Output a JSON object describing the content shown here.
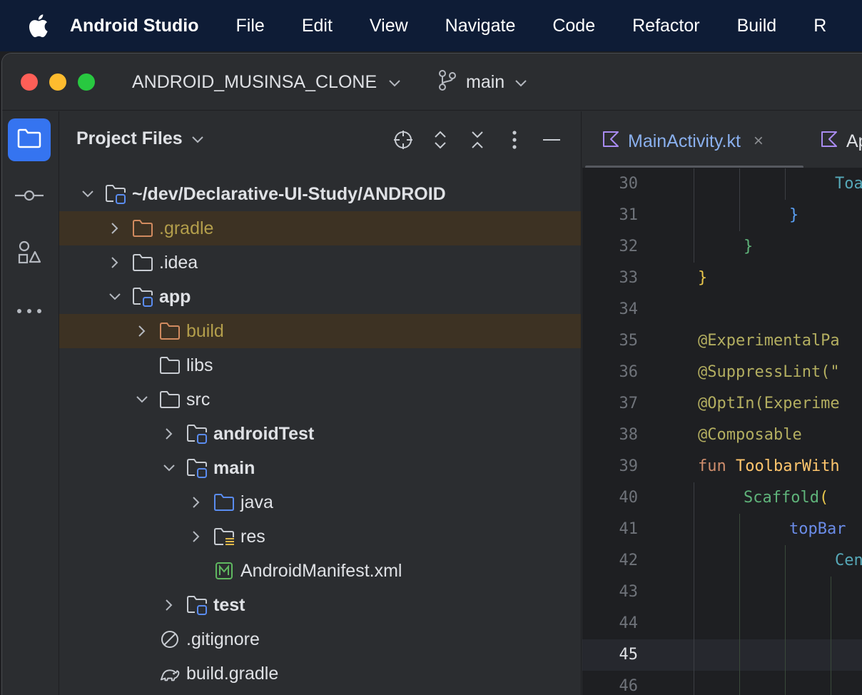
{
  "menubar": {
    "app_name": "Android Studio",
    "items": [
      "File",
      "Edit",
      "View",
      "Navigate",
      "Code",
      "Refactor",
      "Build",
      "R"
    ]
  },
  "titlebar": {
    "project": "ANDROID_MUSINSA_CLONE",
    "branch": "main"
  },
  "colors": {
    "accent": "#3574f0",
    "menubar_bg": "#0e1c36",
    "panel_bg": "#2b2d30",
    "editor_bg": "#1e1f22",
    "excluded_bg": "#3d3223"
  },
  "toolstrip": {
    "icons": [
      "folder-icon",
      "commit-icon",
      "shapes-icon",
      "more-icon"
    ]
  },
  "project_panel": {
    "title": "Project Files",
    "tree": [
      {
        "label": "~/dev/Declarative-UI-Study/ANDROID",
        "indent": 0,
        "arrow": "down",
        "icon": "module",
        "bold": true,
        "excluded": false
      },
      {
        "label": ".gradle",
        "indent": 1,
        "arrow": "right",
        "icon": "folder-excluded",
        "bold": false,
        "excluded": true
      },
      {
        "label": ".idea",
        "indent": 1,
        "arrow": "right",
        "icon": "folder",
        "bold": false,
        "excluded": false
      },
      {
        "label": "app",
        "indent": 1,
        "arrow": "down",
        "icon": "module",
        "bold": true,
        "excluded": false
      },
      {
        "label": "build",
        "indent": 2,
        "arrow": "right",
        "icon": "folder-excluded",
        "bold": false,
        "excluded": true
      },
      {
        "label": "libs",
        "indent": 2,
        "arrow": "none",
        "icon": "folder",
        "bold": false,
        "excluded": false
      },
      {
        "label": "src",
        "indent": 2,
        "arrow": "down",
        "icon": "folder",
        "bold": false,
        "excluded": false
      },
      {
        "label": "androidTest",
        "indent": 3,
        "arrow": "right",
        "icon": "module",
        "bold": true,
        "excluded": false
      },
      {
        "label": "main",
        "indent": 3,
        "arrow": "down",
        "icon": "module",
        "bold": true,
        "excluded": false
      },
      {
        "label": "java",
        "indent": 4,
        "arrow": "right",
        "icon": "folder-source",
        "bold": false,
        "excluded": false
      },
      {
        "label": "res",
        "indent": 4,
        "arrow": "right",
        "icon": "folder-res",
        "bold": false,
        "excluded": false
      },
      {
        "label": "AndroidManifest.xml",
        "indent": 4,
        "arrow": "none",
        "icon": "manifest",
        "bold": false,
        "excluded": false
      },
      {
        "label": "test",
        "indent": 3,
        "arrow": "right",
        "icon": "module",
        "bold": true,
        "excluded": false
      },
      {
        "label": ".gitignore",
        "indent": 2,
        "arrow": "none",
        "icon": "ignore",
        "bold": false,
        "excluded": false
      },
      {
        "label": "build.gradle",
        "indent": 2,
        "arrow": "none",
        "icon": "gradle",
        "bold": false,
        "excluded": false
      }
    ]
  },
  "editor": {
    "tabs": [
      {
        "label": "MainActivity.kt",
        "active": true
      },
      {
        "label": "Ap",
        "active": false
      }
    ],
    "lines": [
      {
        "n": "30",
        "segments": [
          {
            "t": "Toa",
            "c": "c-teal"
          }
        ],
        "col": 3
      },
      {
        "n": "31",
        "segments": [
          {
            "t": "}",
            "c": "c-blue"
          }
        ],
        "col": 2
      },
      {
        "n": "32",
        "segments": [
          {
            "t": "}",
            "c": "c-green"
          }
        ],
        "col": 1
      },
      {
        "n": "33",
        "segments": [
          {
            "t": "}",
            "c": "c-yel"
          }
        ],
        "col": 0
      },
      {
        "n": "34",
        "segments": [],
        "col": 0
      },
      {
        "n": "35",
        "segments": [
          {
            "t": "@ExperimentalPa",
            "c": "c-ann"
          }
        ],
        "col": 0
      },
      {
        "n": "36",
        "segments": [
          {
            "t": "@SuppressLint(\"",
            "c": "c-ann"
          }
        ],
        "col": 0
      },
      {
        "n": "37",
        "segments": [
          {
            "t": "@OptIn(Experime",
            "c": "c-ann"
          }
        ],
        "col": 0
      },
      {
        "n": "38",
        "segments": [
          {
            "t": "@Composable",
            "c": "c-ann"
          }
        ],
        "col": 0
      },
      {
        "n": "39",
        "segments": [
          {
            "t": "fun ",
            "c": "c-kw"
          },
          {
            "t": "ToolbarWith",
            "c": "c-fn"
          }
        ],
        "col": 0
      },
      {
        "n": "40",
        "segments": [
          {
            "t": "Scaffold",
            "c": "c-green"
          },
          {
            "t": "(",
            "c": "c-yel"
          }
        ],
        "col": 1
      },
      {
        "n": "41",
        "segments": [
          {
            "t": "topBar",
            "c": "c-prop"
          }
        ],
        "col": 2
      },
      {
        "n": "42",
        "segments": [
          {
            "t": "Cen",
            "c": "c-teal"
          }
        ],
        "col": 3
      },
      {
        "n": "43",
        "segments": [],
        "col": 0
      },
      {
        "n": "44",
        "segments": [],
        "col": 0
      },
      {
        "n": "45",
        "segments": [],
        "col": 0,
        "current": true
      },
      {
        "n": "46",
        "segments": [],
        "col": 0
      }
    ]
  }
}
